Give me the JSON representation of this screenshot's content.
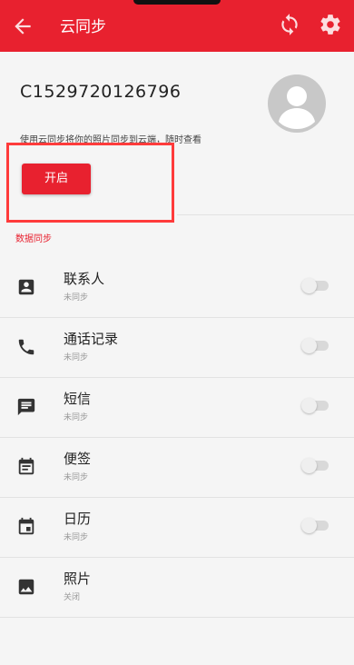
{
  "header": {
    "title": "云同步",
    "back_icon": "arrow-left-icon",
    "sync_icon": "sync-icon",
    "settings_icon": "gear-icon",
    "bar_color": "#e8212f"
  },
  "account": {
    "id": "C1529720126796",
    "description": "使用云同步将你的照片同步到云端，随时查看",
    "enable_button": "开启",
    "avatar_icon": "person-avatar-icon"
  },
  "section_label": "数据同步",
  "items": [
    {
      "label": "联系人",
      "status": "未同步",
      "icon": "contact-card-icon",
      "toggle": false
    },
    {
      "label": "通话记录",
      "status": "未同步",
      "icon": "phone-icon",
      "toggle": false
    },
    {
      "label": "短信",
      "status": "未同步",
      "icon": "message-icon",
      "toggle": false
    },
    {
      "label": "便签",
      "status": "未同步",
      "icon": "note-icon",
      "toggle": false
    },
    {
      "label": "日历",
      "status": "未同步",
      "icon": "calendar-icon",
      "toggle": false
    },
    {
      "label": "照片",
      "status": "关闭",
      "icon": "image-icon"
    }
  ]
}
